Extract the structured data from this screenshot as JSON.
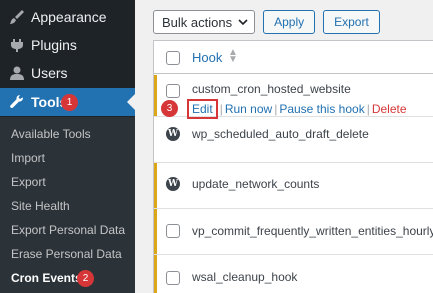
{
  "sidebar": {
    "menu": [
      {
        "label": "Appearance",
        "icon": "brush-icon"
      },
      {
        "label": "Plugins",
        "icon": "plugin-icon"
      },
      {
        "label": "Users",
        "icon": "user-icon"
      },
      {
        "label": "Tools",
        "icon": "wrench-icon",
        "active": true
      }
    ],
    "submenu": [
      "Available Tools",
      "Import",
      "Export",
      "Site Health",
      "Export Personal Data",
      "Erase Personal Data",
      "Cron Events"
    ],
    "current_submenu": "Cron Events"
  },
  "annotations": {
    "tools_badge": "1",
    "cron_badge": "2",
    "edit_badge": "3"
  },
  "toolbar": {
    "bulk_select": "Bulk actions",
    "apply": "Apply",
    "export": "Export"
  },
  "table": {
    "column_hook": "Hook",
    "rows": [
      {
        "hook": "custom_cron_hosted_website",
        "icon": "none",
        "paused": true
      },
      {
        "hook": "wp_scheduled_auto_draft_delete",
        "icon": "wordpress-icon",
        "paused": false
      },
      {
        "hook": "update_network_counts",
        "icon": "wordpress-icon",
        "paused": true
      },
      {
        "hook": "vp_commit_frequently_written_entities_hourly",
        "icon": "none",
        "paused": true
      },
      {
        "hook": "wsal_cleanup_hook",
        "icon": "none",
        "paused": true
      }
    ],
    "row_actions": {
      "edit": "Edit",
      "run_now": "Run now",
      "pause": "Pause this hook",
      "delete": "Delete"
    }
  },
  "colors": {
    "accent": "#2271b1",
    "sidebar": "#1d2327",
    "submenu": "#2c3338",
    "danger": "#d63638",
    "paused_bar": "#dba617"
  }
}
